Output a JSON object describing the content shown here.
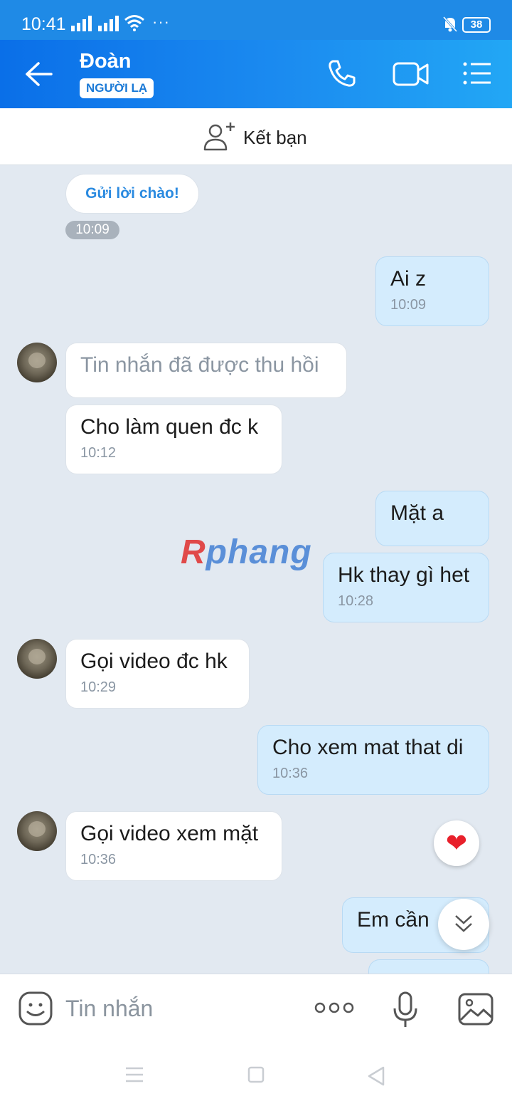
{
  "status_bar": {
    "time": "10:41",
    "dots": "···",
    "battery": "38"
  },
  "header": {
    "name": "Đoàn",
    "badge": "NGƯỜI LẠ"
  },
  "add_friend": {
    "label": "Kết bạn"
  },
  "greeting": {
    "label": "Gửi lời chào!",
    "time": "10:09"
  },
  "messages": [
    {
      "dir": "out",
      "text": "Ai z",
      "time": "10:09"
    },
    {
      "dir": "in",
      "text": "Tin nhắn đã được thu hồi",
      "recalled": true
    },
    {
      "dir": "in",
      "text": "Cho làm quen đc k",
      "time": "10:12"
    },
    {
      "dir": "out",
      "text": "Mặt a"
    },
    {
      "dir": "out",
      "text": "Hk thay gì het",
      "time": "10:28"
    },
    {
      "dir": "in",
      "text": "Gọi video đc hk",
      "time": "10:29"
    },
    {
      "dir": "out",
      "text": "Cho xem mat that di",
      "time": "10:36"
    },
    {
      "dir": "in",
      "text": "Gọi video xem mặt",
      "time": "10:36"
    },
    {
      "dir": "out",
      "text": "Em cần "
    }
  ],
  "watermark": {
    "r": "R",
    "rest": "phang"
  },
  "reaction": {
    "heart": "❤"
  },
  "input": {
    "placeholder": "Tin nhắn"
  },
  "icons": [
    "back-arrow-icon",
    "phone-icon",
    "video-call-icon",
    "menu-list-icon",
    "add-friend-icon",
    "emoji-icon",
    "more-icon",
    "mic-icon",
    "image-icon",
    "chevron-down-icon"
  ]
}
